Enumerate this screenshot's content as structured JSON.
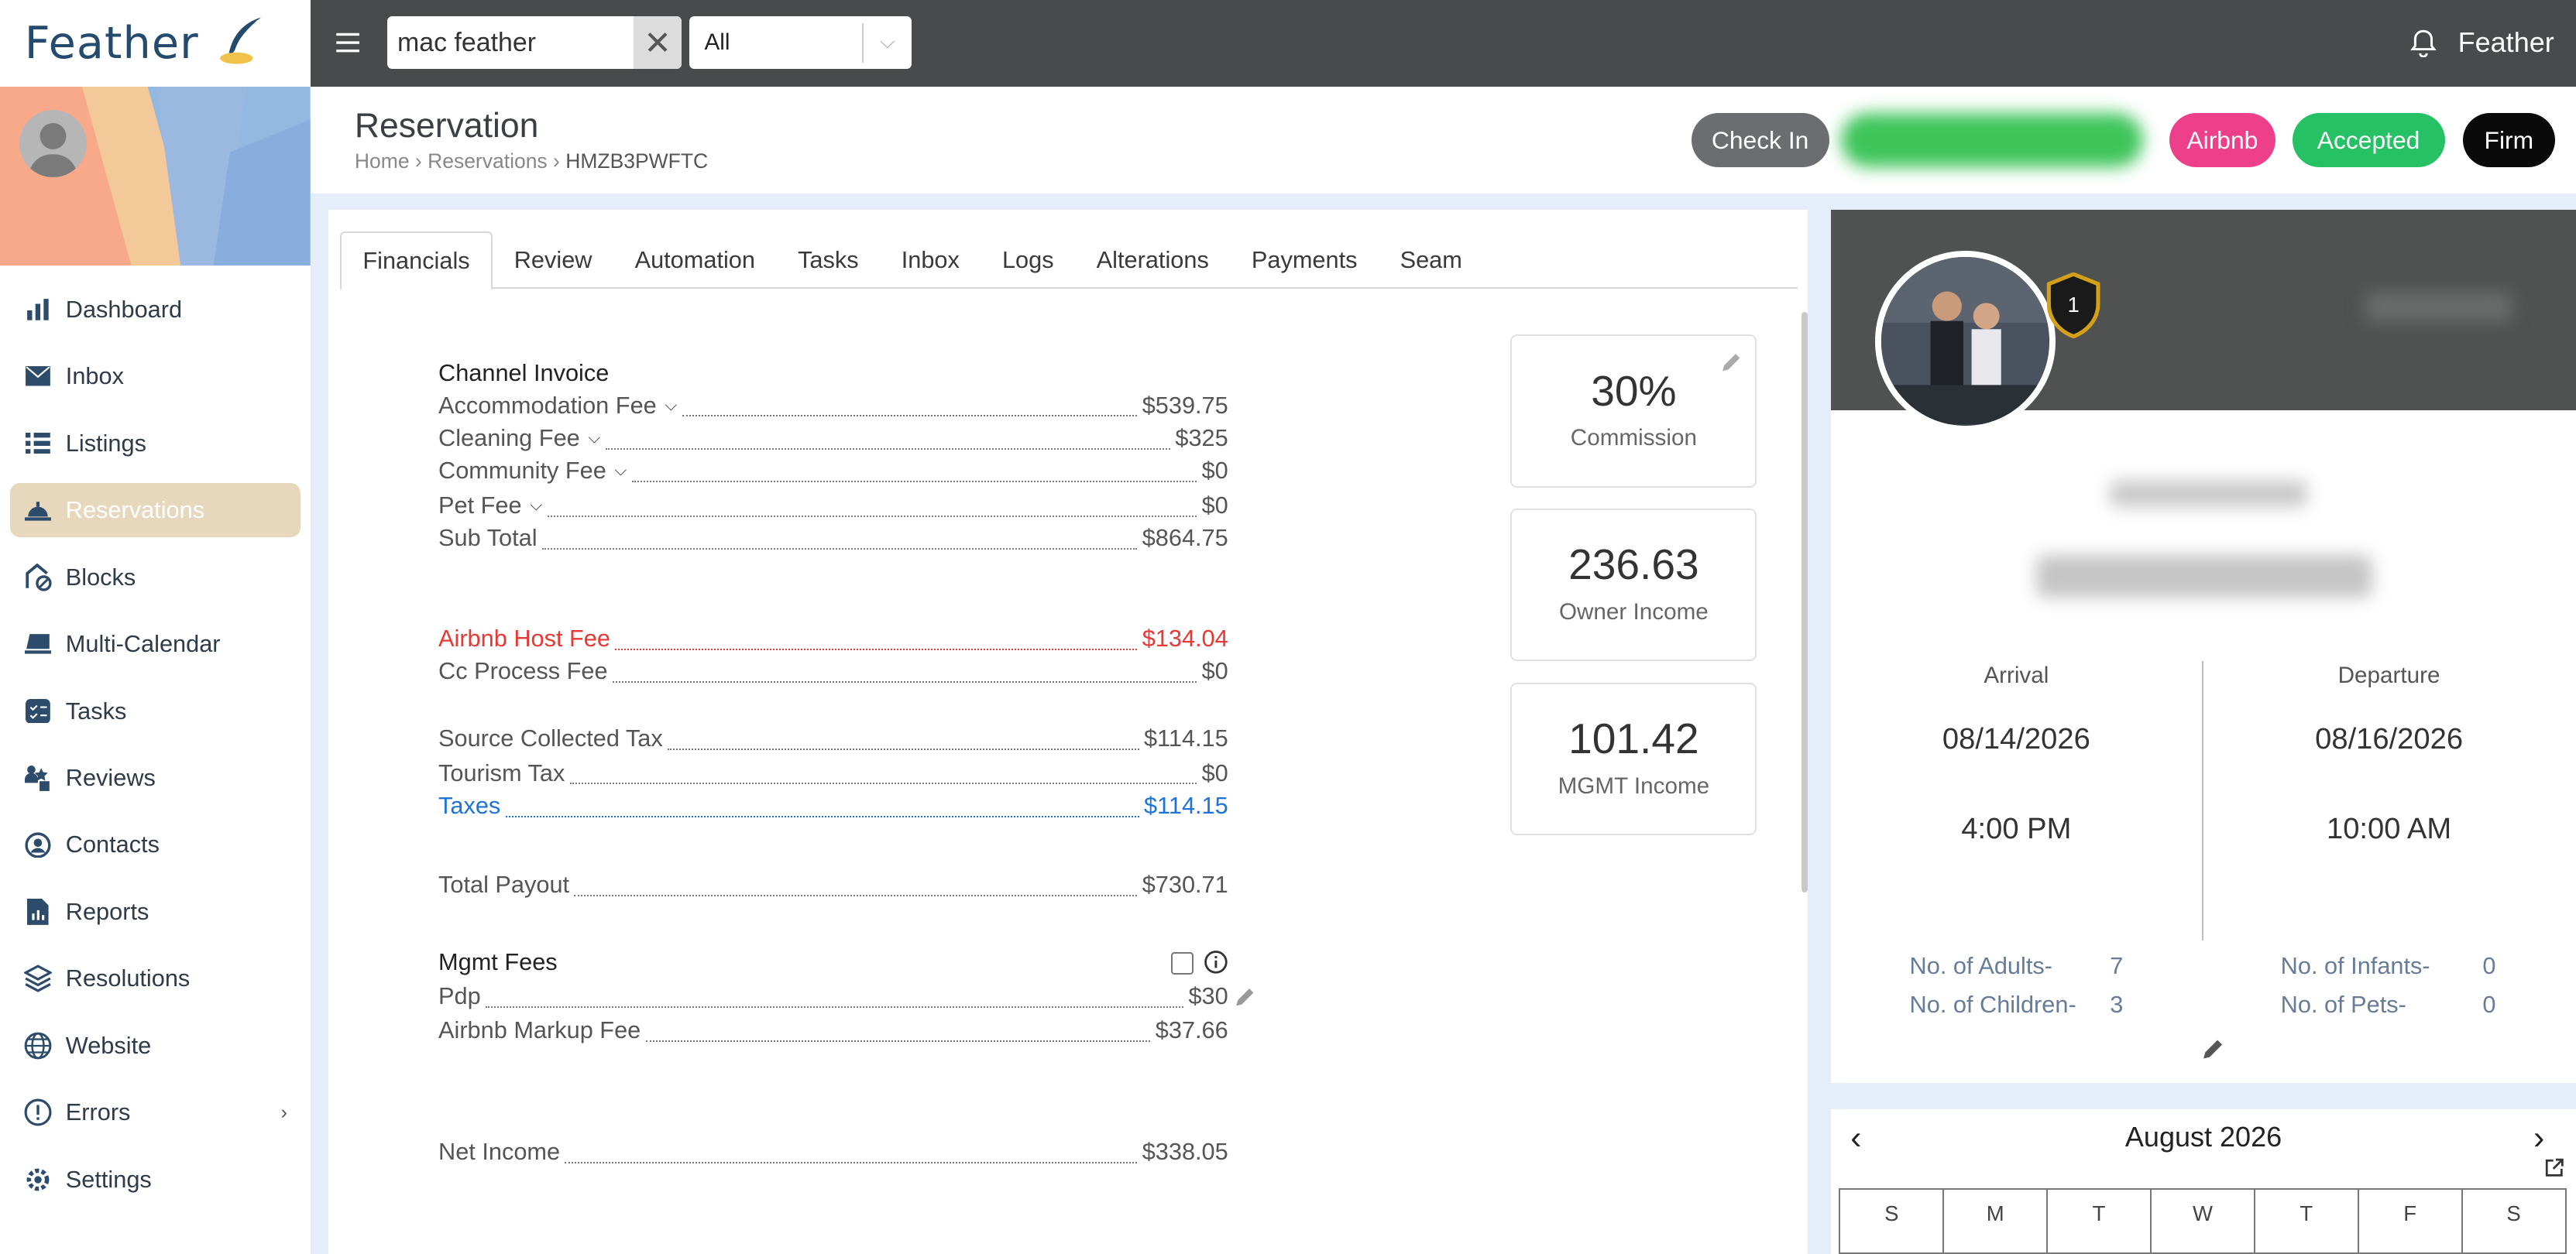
{
  "brand": {
    "name": "Feather"
  },
  "topbar": {
    "search_value": "mac feather",
    "filter_value": "All",
    "user_name": "Feather"
  },
  "sidebar": {
    "items": [
      {
        "label": "Dashboard",
        "icon": "bar-chart-icon"
      },
      {
        "label": "Inbox",
        "icon": "mail-icon"
      },
      {
        "label": "Listings",
        "icon": "list-icon"
      },
      {
        "label": "Reservations",
        "icon": "bell-service-icon",
        "active": true
      },
      {
        "label": "Blocks",
        "icon": "block-icon"
      },
      {
        "label": "Multi-Calendar",
        "icon": "calendar-icon"
      },
      {
        "label": "Tasks",
        "icon": "tasks-icon"
      },
      {
        "label": "Reviews",
        "icon": "reviews-icon"
      },
      {
        "label": "Contacts",
        "icon": "contact-icon"
      },
      {
        "label": "Reports",
        "icon": "report-icon"
      },
      {
        "label": "Resolutions",
        "icon": "layers-icon"
      },
      {
        "label": "Website",
        "icon": "globe-icon"
      },
      {
        "label": "Errors",
        "icon": "alert-icon"
      },
      {
        "label": "Settings",
        "icon": "settings-icon"
      }
    ]
  },
  "header": {
    "title": "Reservation",
    "breadcrumb": [
      "Home",
      "Reservations",
      "HMZB3PWFTC"
    ],
    "buttons": {
      "check_in": "Check In",
      "channel": "Airbnb",
      "status": "Accepted",
      "type": "Firm"
    }
  },
  "tabs": [
    "Financials",
    "Review",
    "Automation",
    "Tasks",
    "Inbox",
    "Logs",
    "Alterations",
    "Payments",
    "Seam"
  ],
  "financials": {
    "channel_invoice_title": "Channel Invoice",
    "rows": [
      {
        "label": "Accommodation Fee",
        "value": "$539.75"
      },
      {
        "label": "Cleaning Fee",
        "value": "$325"
      },
      {
        "label": "Community Fee",
        "value": "$0"
      },
      {
        "label": "Pet Fee",
        "value": "$0"
      },
      {
        "label": "Sub Total",
        "value": "$864.75"
      },
      {
        "label": "Airbnb Host Fee",
        "value": "$134.04"
      },
      {
        "label": "Cc Process Fee",
        "value": "$0"
      },
      {
        "label": "Source Collected Tax",
        "value": "$114.15"
      },
      {
        "label": "Tourism Tax",
        "value": "$0"
      },
      {
        "label": "Taxes",
        "value": "$114.15"
      },
      {
        "label": "Total Payout",
        "value": "$730.71"
      },
      {
        "label": "Pdp",
        "value": "$30"
      },
      {
        "label": "Airbnb Markup Fee",
        "value": "$37.66"
      },
      {
        "label": "Net Income",
        "value": "$338.05"
      }
    ],
    "mgmt_fees_title": "Mgmt Fees"
  },
  "stats": [
    {
      "value": "30%",
      "label": "Commission"
    },
    {
      "value": "236.63",
      "label": "Owner Income"
    },
    {
      "value": "101.42",
      "label": "MGMT Income"
    }
  ],
  "guest": {
    "badge_level": "1",
    "arrival_label": "Arrival",
    "arrival_date": "08/14/2026",
    "arrival_time": "4:00 PM",
    "departure_label": "Departure",
    "departure_date": "08/16/2026",
    "departure_time": "10:00 AM",
    "adults_label": "No. of Adults-",
    "adults": "7",
    "children_label": "No. of Children-",
    "children": "3",
    "infants_label": "No. of Infants-",
    "infants": "0",
    "pets_label": "No. of Pets-",
    "pets": "0"
  },
  "calendar": {
    "month": "August 2026",
    "weekdays": [
      "S",
      "M",
      "T",
      "W",
      "T",
      "F",
      "S"
    ]
  },
  "colors": {
    "accent": "#e7d7bd",
    "airbnb": "#ee3f8a",
    "accepted": "#26c165",
    "red": "#e53935",
    "blue": "#1e73d8"
  }
}
